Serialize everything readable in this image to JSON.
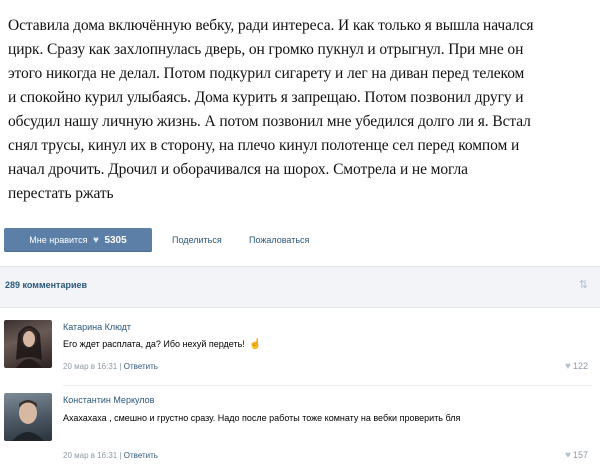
{
  "post": {
    "lines": [
      "Оставила дома включённую вебку, ради интереса. И как только я вышла начался",
      "цирк. Сразу как захлопнулась дверь, он громко пукнул и отрыгнул. При мне он",
      "этого никогда не делал. Потом подкурил сигарету и лег на диван перед телеком",
      "и спокойно курил улыбаясь. Дома курить я запрещаю. Потом позвонил другу и",
      "обсудил нашу личную жизнь. А потом позвонил мне убедился долго ли я. Встал",
      "снял трусы, кинул их в сторону, на плечо кинул полотенце сел перед компом и",
      "начал дрочить. Дрочил и оборачивался на шорох. Смотрела и не могла",
      "перестать ржать"
    ]
  },
  "actions": {
    "like_label": "Мне нравится",
    "like_count": "5305",
    "share_label": "Поделиться",
    "report_label": "Пожаловаться"
  },
  "comments_header": {
    "count_label": "289 комментариев"
  },
  "comments": [
    {
      "author": "Катарина Клюдт",
      "text": "Его ждет расплата, да? Ибо нехуй пердеть!",
      "date": "20 мар в 16:31",
      "reply_label": "Ответить",
      "likes": "122"
    },
    {
      "author": "Константин Меркулов",
      "text": "Ахахахаха , смешно и грустно сразу. Надо после работы тоже комнату на вебки проверить бля",
      "date": "20 мар в 16:31",
      "reply_label": "Ответить",
      "likes": "157"
    }
  ],
  "colors": {
    "accent": "#5b7fa6",
    "link": "#2b587a",
    "meta": "#8d99a6",
    "bar_bg": "#f2f4f7"
  },
  "icons": [
    "heart-icon",
    "sort-icon",
    "hand-emoji-icon",
    "avatar"
  ]
}
